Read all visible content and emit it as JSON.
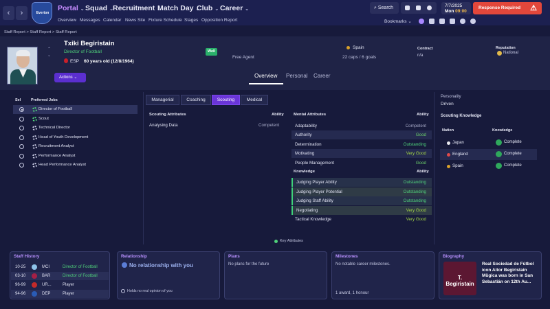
{
  "nav": {
    "menus": [
      {
        "label": "Portal"
      },
      {
        "label": "Squad"
      },
      {
        "label": "Recruitment"
      },
      {
        "label": "Match Day"
      },
      {
        "label": "Club"
      },
      {
        "label": "Career"
      }
    ],
    "submenus": [
      "Overview",
      "Messages",
      "Calendar",
      "News Site",
      "Fixture Schedule",
      "Stages",
      "Opposition Report"
    ],
    "search_label": "Search",
    "date": "7/7/2025",
    "day": "Mon",
    "time": "09:00",
    "response_label": "Response Required",
    "bookmarks_label": "Bookmarks"
  },
  "crest_text": "Everton",
  "breadcrumbs": "Staff Report  >  Staff Report  >  Staff Report",
  "person": {
    "name": "Txiki Begiristain",
    "role": "Director of Football",
    "nationality": "ESP",
    "age": "60 years old (12/8/1964)",
    "wellbeing": "Well",
    "agent": "Free Agent",
    "club": "Spain",
    "caps": "22 caps / 6 goals",
    "contract_label": "Contract",
    "contract_value": "n/a",
    "reputation_label": "Reputation",
    "reputation_value": "National",
    "actions_label": "Actions"
  },
  "tabs": [
    "Overview",
    "Personal",
    "Career"
  ],
  "jobs": {
    "sel_header": "Sel",
    "jobs_header": "Preferred Jobs",
    "items": [
      {
        "label": "Director of Football",
        "selected": true,
        "preferred": true
      },
      {
        "label": "Scout",
        "selected": false,
        "preferred": true
      },
      {
        "label": "Technical Director",
        "selected": false,
        "preferred": false
      },
      {
        "label": "Head of Youth Development",
        "selected": false,
        "preferred": false
      },
      {
        "label": "Recruitment Analyst",
        "selected": false,
        "preferred": false
      },
      {
        "label": "Performance Analyst",
        "selected": false,
        "preferred": false
      },
      {
        "label": "Head Performance Analyst",
        "selected": false,
        "preferred": false
      }
    ]
  },
  "attr_tabs": [
    "Managerial",
    "Coaching",
    "Scouting",
    "Medical"
  ],
  "scouting": {
    "header": "Scouting Attributes",
    "ability_header": "Ability",
    "rows": [
      {
        "label": "Analysing Data",
        "value": "Competent"
      }
    ]
  },
  "mental": {
    "header": "Mental Attributes",
    "ability_header": "Ability",
    "rows": [
      {
        "label": "Adaptability",
        "value": "Competent"
      },
      {
        "label": "Authority",
        "value": "Good"
      },
      {
        "label": "Determination",
        "value": "Outstanding"
      },
      {
        "label": "Motivating",
        "value": "Very Good"
      },
      {
        "label": "People Management",
        "value": "Good"
      }
    ]
  },
  "knowledge": {
    "header": "Knowledge",
    "ability_header": "Ability",
    "rows": [
      {
        "label": "Judging Player Ability",
        "value": "Outstanding"
      },
      {
        "label": "Judging Player Potential",
        "value": "Outstanding"
      },
      {
        "label": "Judging Staff Ability",
        "value": "Outstanding"
      },
      {
        "label": "Negotiating",
        "value": "Very Good"
      },
      {
        "label": "Tactical Knowledge",
        "value": "Very Good"
      }
    ]
  },
  "key_attributes_label": "Key Attributes",
  "personality": {
    "label": "Personality",
    "value": "Driven"
  },
  "scouting_knowledge": {
    "title": "Scouting Knowledge",
    "nation_header": "Nation",
    "knowledge_header": "Knowledge",
    "rows": [
      {
        "nation": "Japan",
        "knowledge": "Complete"
      },
      {
        "nation": "England",
        "knowledge": "Complete"
      },
      {
        "nation": "Spain",
        "knowledge": "Complete"
      }
    ]
  },
  "staff_history": {
    "title": "Staff History",
    "rows": [
      {
        "years": "10-25",
        "club": "MCI",
        "role": "Director of Football"
      },
      {
        "years": "03-10",
        "club": "BAR",
        "role": "Director of Football"
      },
      {
        "years": "96-99",
        "club": "UR...",
        "role": "Player"
      },
      {
        "years": "94-96",
        "club": "DEP",
        "role": "Player"
      }
    ]
  },
  "relationship": {
    "title": "Relationship",
    "main": "No relationship with you",
    "footer": "Holds no real opinion of you"
  },
  "plans": {
    "title": "Plans",
    "text": "No plans for the future"
  },
  "milestones": {
    "title": "Milestones",
    "text": "No notable career milestones.",
    "footer": "1 award, 1 honour"
  },
  "biography": {
    "title": "Biography",
    "image_text": "T. Begiristain",
    "text": "Real Sociedad de Fútbol icon Aitor Begiristain Mügica was born in San Sebastián on 12th Au..."
  },
  "colors": {
    "accent": "#6a35d8",
    "positive": "#4fd17a",
    "alert": "#e2473b",
    "background": "#171a3b"
  }
}
